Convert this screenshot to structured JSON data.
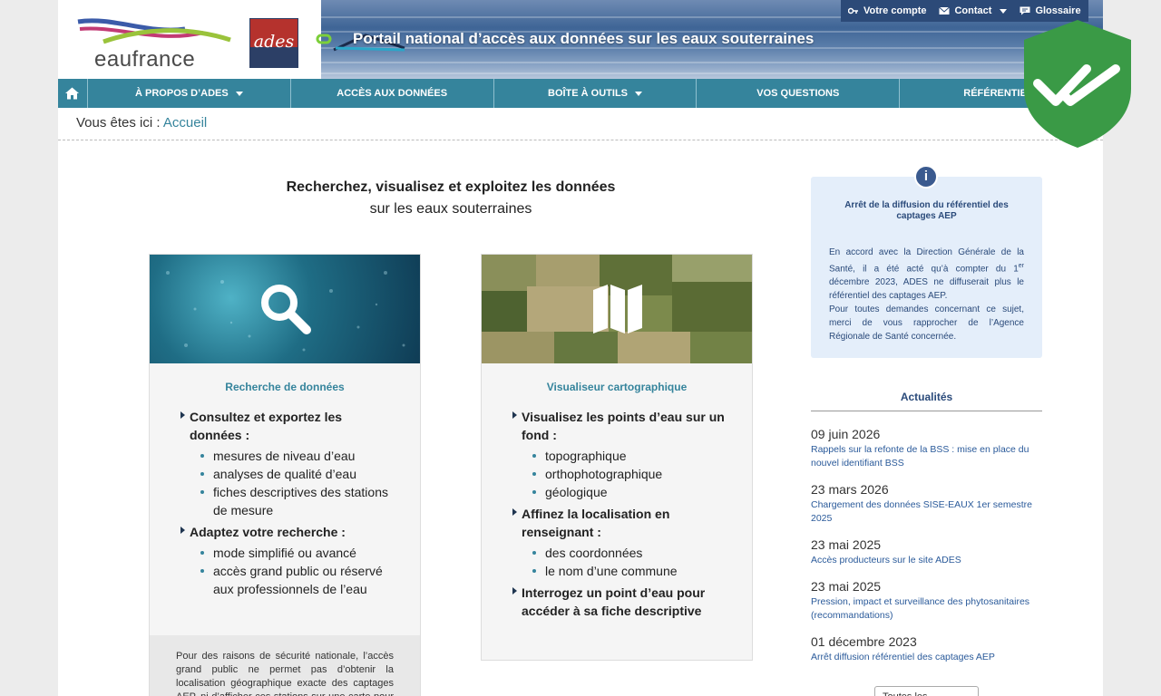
{
  "header": {
    "logo_text": "eaufrance",
    "ades_logo": "ades",
    "portal_title": "Portail national d’accès aux données sur les eaux souterraines",
    "top_links": [
      {
        "label": "Votre compte",
        "icon": "key-icon"
      },
      {
        "label": "Contact",
        "icon": "envelope-icon"
      },
      {
        "label": "Glossaire",
        "icon": "chat-icon"
      }
    ]
  },
  "nav": {
    "home_icon": "home-icon",
    "items": [
      {
        "label": "À propos d’ADES"
      },
      {
        "label": "Accès aux données"
      },
      {
        "label": "Boîte à outils"
      },
      {
        "label": "Vos questions"
      },
      {
        "label": "Référentiels"
      }
    ]
  },
  "breadcrumb": {
    "prefix": "Vous êtes ici :",
    "link": "Accueil"
  },
  "intro": {
    "line1": "Recherchez, visualisez et exploitez les données",
    "line2": "sur les eaux souterraines"
  },
  "cards": [
    {
      "title": "Recherche de données",
      "icon": "search-icon",
      "sections": [
        {
          "heading": "Consultez et exportez les données :",
          "items": [
            "mesures de niveau d’eau",
            "analyses de qualité d’eau",
            "fiches descriptives des stations de mesure"
          ]
        },
        {
          "heading": "Adaptez votre recherche :",
          "items": [
            "mode simplifié ou avancé",
            "accès grand public ou réservé aux professionnels de l’eau"
          ]
        }
      ],
      "note": "Pour des raisons de sécurité nationale, l’accès grand public ne permet pas d’obtenir la localisation géographique exacte des captages AEP, ni d’afficher ces stations sur une carte pour des"
    },
    {
      "title": "Visualiseur cartographique",
      "icon": "map-icon",
      "sections": [
        {
          "heading": "Visualisez les points d’eau sur un fond :",
          "items": [
            "topographique",
            "orthophotographique",
            "géologique"
          ]
        },
        {
          "heading": "Affinez la localisation en renseignant :",
          "items": [
            "des coordonnées",
            "le nom d’une commune"
          ]
        },
        {
          "heading": "Interrogez un point d’eau pour accéder à sa fiche descriptive",
          "items": []
        }
      ]
    }
  ],
  "alert": {
    "icon": "info-icon",
    "icon_glyph": "i",
    "title": "Arrêt de la diffusion du référentiel des captages AEP",
    "text_before_sup": "En accord avec la Direction Générale de la Santé, il a été acté qu’à compter du 1",
    "sup": "er",
    "text_after_sup": " décembre 2023, ADES ne diffuserait plus le référentiel des captages AEP.",
    "text2": "Pour toutes demandes concernant ce sujet, merci de vous rapprocher de l’Agence Régionale de Santé concernée."
  },
  "news": {
    "title": "Actualités",
    "items": [
      {
        "date": "09 juin 2026",
        "link": "Rappels sur la refonte de la BSS : mise en place du nouvel identifiant BSS"
      },
      {
        "date": "23 mars 2026",
        "link": "Chargement des données SISE-EAUX 1er semestre 2025"
      },
      {
        "date": "23 mai 2025",
        "link": "Accès producteurs sur le site ADES"
      },
      {
        "date": "23 mai 2025",
        "link": "Pression, impact et surveillance des phytosanitaires (recommandations)"
      },
      {
        "date": "01 décembre 2023",
        "link": "Arrêt diffusion référentiel des captages AEP"
      }
    ],
    "all_label": "Toutes les actualités"
  },
  "colors": {
    "accent": "#35849c",
    "navy": "#2c4a78",
    "alert_bg": "#e4eefa",
    "shield": "#3a9a46"
  },
  "badge_icon": "check-shield-icon"
}
